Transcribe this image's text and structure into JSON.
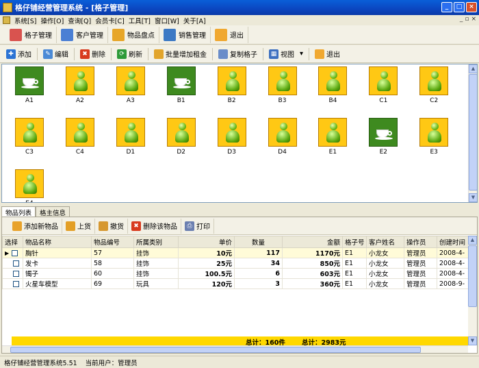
{
  "window": {
    "title": "格仔铺经营管理系统 - [格子管理]"
  },
  "menubar": {
    "items": [
      "系统[S]",
      "操作[O]",
      "查询[Q]",
      "会员卡[C]",
      "工具[T]",
      "窗口[W]",
      "关于[A]"
    ]
  },
  "main_toolbar": {
    "items": [
      {
        "label": "格子管理",
        "icon": "grid-icon"
      },
      {
        "label": "客户管理",
        "icon": "users-icon"
      },
      {
        "label": "物品盘点",
        "icon": "box-icon"
      },
      {
        "label": "销售管理",
        "icon": "cash-register-icon"
      },
      {
        "label": "退出",
        "icon": "exit-icon"
      }
    ]
  },
  "grid_toolbar": {
    "items": [
      {
        "label": "添加",
        "icon": "add-icon"
      },
      {
        "label": "编辑",
        "icon": "edit-icon"
      },
      {
        "label": "删除",
        "icon": "delete-icon"
      },
      {
        "label": "刷新",
        "icon": "refresh-icon"
      },
      {
        "label": "批量增加租金",
        "icon": "batch-rent-icon"
      },
      {
        "label": "复制格子",
        "icon": "copy-icon"
      },
      {
        "label": "视图",
        "icon": "view-icon"
      },
      {
        "label": "退出",
        "icon": "exit-icon"
      }
    ]
  },
  "slots": [
    {
      "name": "A1",
      "state": "occupied"
    },
    {
      "name": "A2",
      "state": "vacant"
    },
    {
      "name": "A3",
      "state": "vacant"
    },
    {
      "name": "B1",
      "state": "occupied"
    },
    {
      "name": "B2",
      "state": "vacant"
    },
    {
      "name": "B3",
      "state": "vacant"
    },
    {
      "name": "B4",
      "state": "vacant"
    },
    {
      "name": "C1",
      "state": "vacant"
    },
    {
      "name": "C2",
      "state": "vacant"
    },
    {
      "name": "C3",
      "state": "vacant"
    },
    {
      "name": "C4",
      "state": "vacant"
    },
    {
      "name": "D1",
      "state": "vacant"
    },
    {
      "name": "D2",
      "state": "vacant"
    },
    {
      "name": "D3",
      "state": "vacant"
    },
    {
      "name": "D4",
      "state": "vacant"
    },
    {
      "name": "E1",
      "state": "vacant"
    },
    {
      "name": "E2",
      "state": "occupied"
    },
    {
      "name": "E3",
      "state": "vacant"
    },
    {
      "name": "E4",
      "state": "vacant"
    }
  ],
  "tabs": [
    "物品列表",
    "格主信息"
  ],
  "item_toolbar": {
    "items": [
      {
        "label": "添加新物品",
        "icon": "add-item-icon"
      },
      {
        "label": "上货",
        "icon": "stock-in-icon"
      },
      {
        "label": "撤货",
        "icon": "stock-out-icon"
      },
      {
        "label": "删除该物品",
        "icon": "delete-icon"
      },
      {
        "label": "打印",
        "icon": "print-icon"
      }
    ]
  },
  "table": {
    "columns": [
      "选择",
      "物品名称",
      "物品编号",
      "所属类别",
      "单价",
      "数量",
      "金额",
      "格子号",
      "客户姓名",
      "操作员",
      "创建时间"
    ],
    "rows": [
      [
        "胸针",
        "57",
        "挂饰",
        "10元",
        "117",
        "1170元",
        "E1",
        "小龙女",
        "管理员",
        "2008-4-"
      ],
      [
        "发卡",
        "58",
        "挂饰",
        "25元",
        "34",
        "850元",
        "E1",
        "小龙女",
        "管理员",
        "2008-4-"
      ],
      [
        "镯子",
        "60",
        "挂饰",
        "100.5元",
        "6",
        "603元",
        "E1",
        "小龙女",
        "管理员",
        "2008-4-"
      ],
      [
        "火星车模型",
        "69",
        "玩具",
        "120元",
        "3",
        "360元",
        "E1",
        "小龙女",
        "管理员",
        "2008-9-"
      ]
    ],
    "totals": {
      "quantity": "总计：160件",
      "amount": "总计：2983元"
    }
  },
  "statusbar": {
    "version": "格仔铺经营管理系统5.51",
    "user": "当前用户：管理员"
  }
}
